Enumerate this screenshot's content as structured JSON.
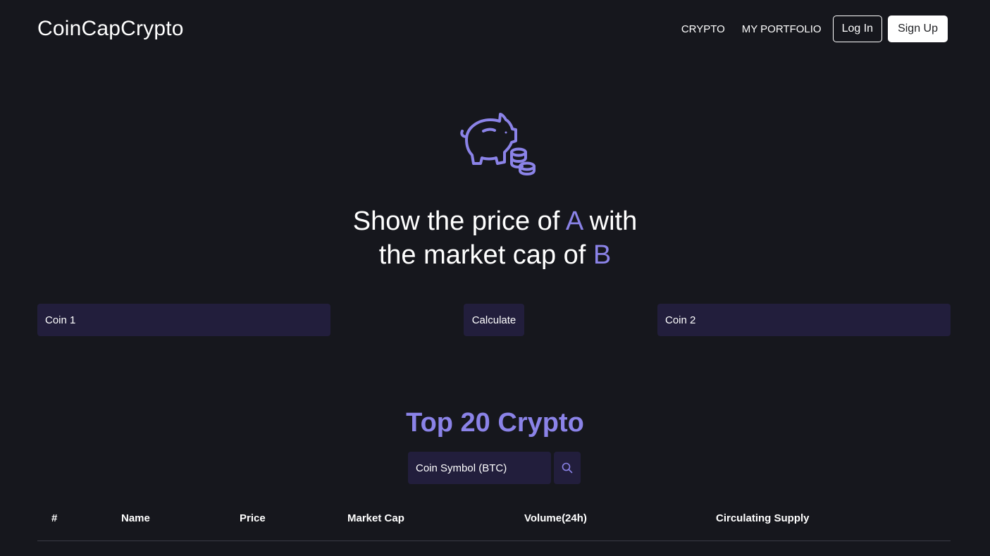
{
  "navbar": {
    "brand": "CoinCapCrypto",
    "links": [
      "CRYPTO",
      "MY PORTFOLIO"
    ],
    "login_label": "Log In",
    "signup_label": "Sign Up"
  },
  "hero": {
    "icon": "piggy-bank-coins-icon",
    "title_part1": "Show the price of ",
    "title_a": "A",
    "title_part2": " with",
    "title_part3": "the market cap of ",
    "title_b": "B"
  },
  "calculator": {
    "coin1_placeholder": "Coin 1",
    "calculate_label": "Calculate",
    "coin2_placeholder": "Coin 2"
  },
  "top_coins": {
    "title": "Top 20 Crypto",
    "search_placeholder": "Coin Symbol (BTC)",
    "search_icon": "search-icon",
    "columns": [
      "#",
      "Name",
      "Price",
      "Market Cap",
      "Volume(24h)",
      "Circulating Supply"
    ],
    "rows": []
  },
  "colors": {
    "background": "#16171d",
    "accent": "#8b83e8",
    "input_background": "#221e3c"
  }
}
